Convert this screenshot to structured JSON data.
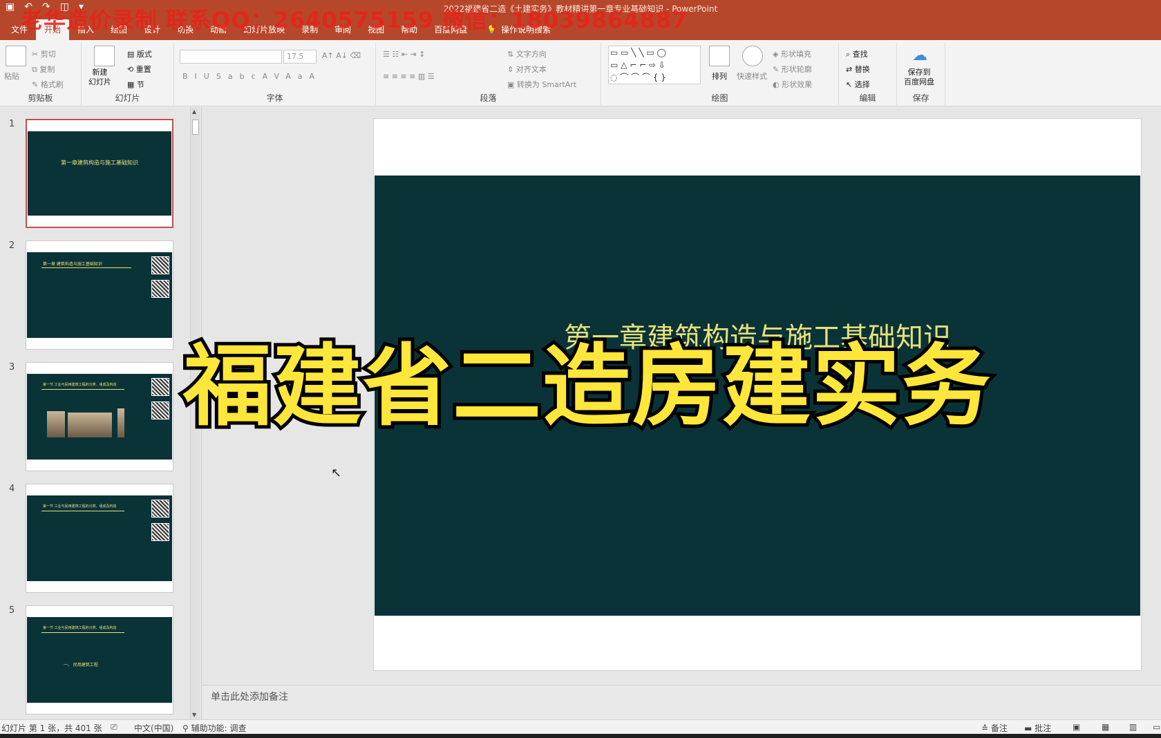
{
  "titlebar": {
    "title": "2022福建省二造《土建实务》教材精讲第一章专业基础知识  -  PowerPoint",
    "watermark": "老华造价录制 联系QQ：2640575159 微信：18039864887",
    "qat_icons": [
      "save-icon",
      "undo-icon",
      "redo-icon",
      "present-icon",
      "customize-icon"
    ]
  },
  "tabs": [
    "文件",
    "开始",
    "插入",
    "绘图",
    "设计",
    "切换",
    "动画",
    "幻灯片放映",
    "录制",
    "审阅",
    "视图",
    "帮助",
    "百度网盘"
  ],
  "active_tab": "开始",
  "tell_me": "操作说明搜索",
  "ribbon": {
    "clipboard": {
      "label": "剪贴板",
      "paste": "粘贴",
      "cut": "剪切",
      "copy": "复制",
      "format_painter": "格式刷"
    },
    "slides": {
      "label": "幻灯片",
      "new_slide": "新建\n幻灯片",
      "layout": "版式",
      "reset": "重置",
      "section": "节"
    },
    "font": {
      "label": "字体",
      "font_name": "",
      "font_size": "17.5",
      "buttons": [
        "B",
        "I",
        "U",
        "S",
        "abc",
        "AV",
        "Aa",
        "A"
      ]
    },
    "paragraph": {
      "label": "段落",
      "text_direction": "文字方向",
      "align_text": "对齐文本",
      "smartart": "转换为 SmartArt"
    },
    "drawing": {
      "label": "绘图",
      "arrange": "排列",
      "quick_styles": "快速样式",
      "shape_fill": "形状填充",
      "shape_outline": "形状轮廓",
      "shape_effects": "形状效果"
    },
    "editing": {
      "label": "编辑",
      "find": "查找",
      "replace": "替换",
      "select": "选择"
    },
    "save": {
      "label": "保存",
      "save_to_baidu": "保存到\n百度网盘"
    }
  },
  "thumbnails": [
    {
      "num": "1",
      "title": "第一章建筑构造与施工基础知识",
      "selected": true
    },
    {
      "num": "2",
      "title": "第一章  建筑构造与施工基础知识",
      "selected": false
    },
    {
      "num": "3",
      "title": "第一节  工业与民用建筑工程的分类、组成及构造",
      "selected": false
    },
    {
      "num": "4",
      "title": "第一节  工业与民用建筑工程的分类、组成及构造",
      "selected": false
    },
    {
      "num": "5",
      "title": "第一节  工业与民用建筑工程的分类、组成及构造",
      "selected": false,
      "sub": "一、  民用建筑工程"
    }
  ],
  "slide": {
    "title": "第一章建筑构造与施工基础知识"
  },
  "overlay_text": "福建省二造房建实务",
  "notes_placeholder": "单击此处添加备注",
  "statusbar": {
    "slide_info": "幻灯片 第 1 张，共 401 张",
    "language": "中文(中国)",
    "accessibility": "辅助功能: 调查",
    "notes": "备注",
    "comments": "批注"
  },
  "colors": {
    "accent": "#b7472a",
    "slide_bg": "#0a3338",
    "slide_title": "#e8e07a",
    "overlay_fill": "#ffe63b",
    "watermark": "#e8231a"
  }
}
